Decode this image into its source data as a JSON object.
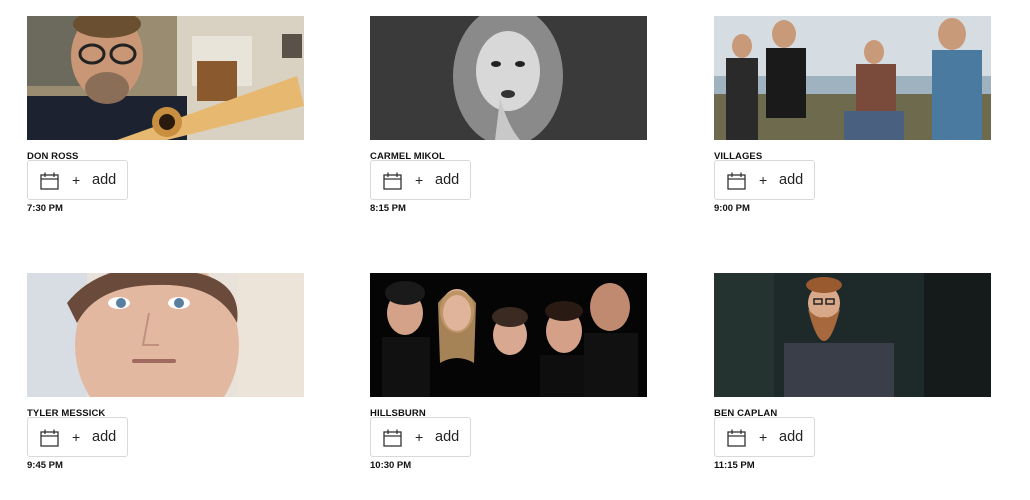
{
  "events": [
    {
      "name": "DON ROSS",
      "time": "7:30 PM",
      "add_label": "add",
      "plus": "+"
    },
    {
      "name": "CARMEL MIKOL",
      "time": "8:15 PM",
      "add_label": "add",
      "plus": "+"
    },
    {
      "name": "VILLAGES",
      "time": "9:00 PM",
      "add_label": "add",
      "plus": "+"
    },
    {
      "name": "TYLER MESSICK",
      "time": "9:45 PM",
      "add_label": "add",
      "plus": "+"
    },
    {
      "name": "HILLSBURN",
      "time": "10:30 PM",
      "add_label": "add",
      "plus": "+"
    },
    {
      "name": "BEN CAPLAN",
      "time": "11:15 PM",
      "add_label": "add",
      "plus": "+"
    }
  ],
  "icons": {
    "calendar": "calendar-icon"
  }
}
